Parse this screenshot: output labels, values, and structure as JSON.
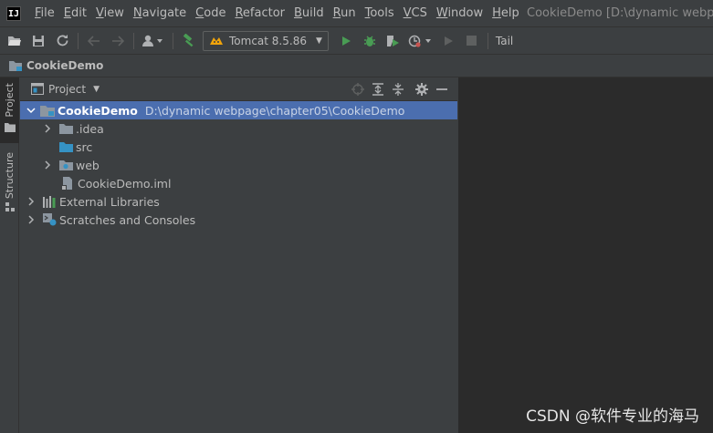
{
  "menu": {
    "logo": "IJ",
    "items": [
      {
        "label": "File",
        "mnemonic": "F",
        "rest": "ile"
      },
      {
        "label": "Edit",
        "mnemonic": "E",
        "rest": "dit"
      },
      {
        "label": "View",
        "mnemonic": "V",
        "rest": "iew"
      },
      {
        "label": "Navigate",
        "mnemonic": "N",
        "rest": "avigate"
      },
      {
        "label": "Code",
        "mnemonic": "C",
        "rest": "ode"
      },
      {
        "label": "Refactor",
        "mnemonic": "R",
        "rest": "efactor"
      },
      {
        "label": "Build",
        "mnemonic": "B",
        "rest": "uild"
      },
      {
        "label": "Run",
        "mnemonic": "R",
        "rest": "un"
      },
      {
        "label": "Tools",
        "mnemonic": "T",
        "rest": "ools"
      },
      {
        "label": "VCS",
        "mnemonic": "V",
        "rest": "CS"
      },
      {
        "label": "Window",
        "mnemonic": "W",
        "rest": "indow"
      },
      {
        "label": "Help",
        "mnemonic": "H",
        "rest": "elp"
      }
    ],
    "window_title": "CookieDemo [D:\\dynamic webpage"
  },
  "toolbar": {
    "run_config": "Tomcat 8.5.86",
    "tail": "Tail"
  },
  "navbar": {
    "project": "CookieDemo"
  },
  "toolstrip": {
    "project_tab": "Project",
    "structure_tab": "Structure"
  },
  "panel": {
    "title": "Project"
  },
  "tree": {
    "root": {
      "name": "CookieDemo",
      "path": "D:\\dynamic webpage\\chapter05\\CookieDemo"
    },
    "idea": ".idea",
    "src": "src",
    "web": "web",
    "iml": "CookieDemo.iml",
    "external": "External Libraries",
    "scratches": "Scratches and Consoles"
  },
  "watermark": "CSDN @软件专业的海马",
  "colors": {
    "selection": "#4b6eaf",
    "panel_bg": "#3c3f41",
    "editor_bg": "#2b2b2b",
    "run_green": "#499c54",
    "folder_gray": "#8c96a0",
    "folder_blue": "#3592c4"
  }
}
